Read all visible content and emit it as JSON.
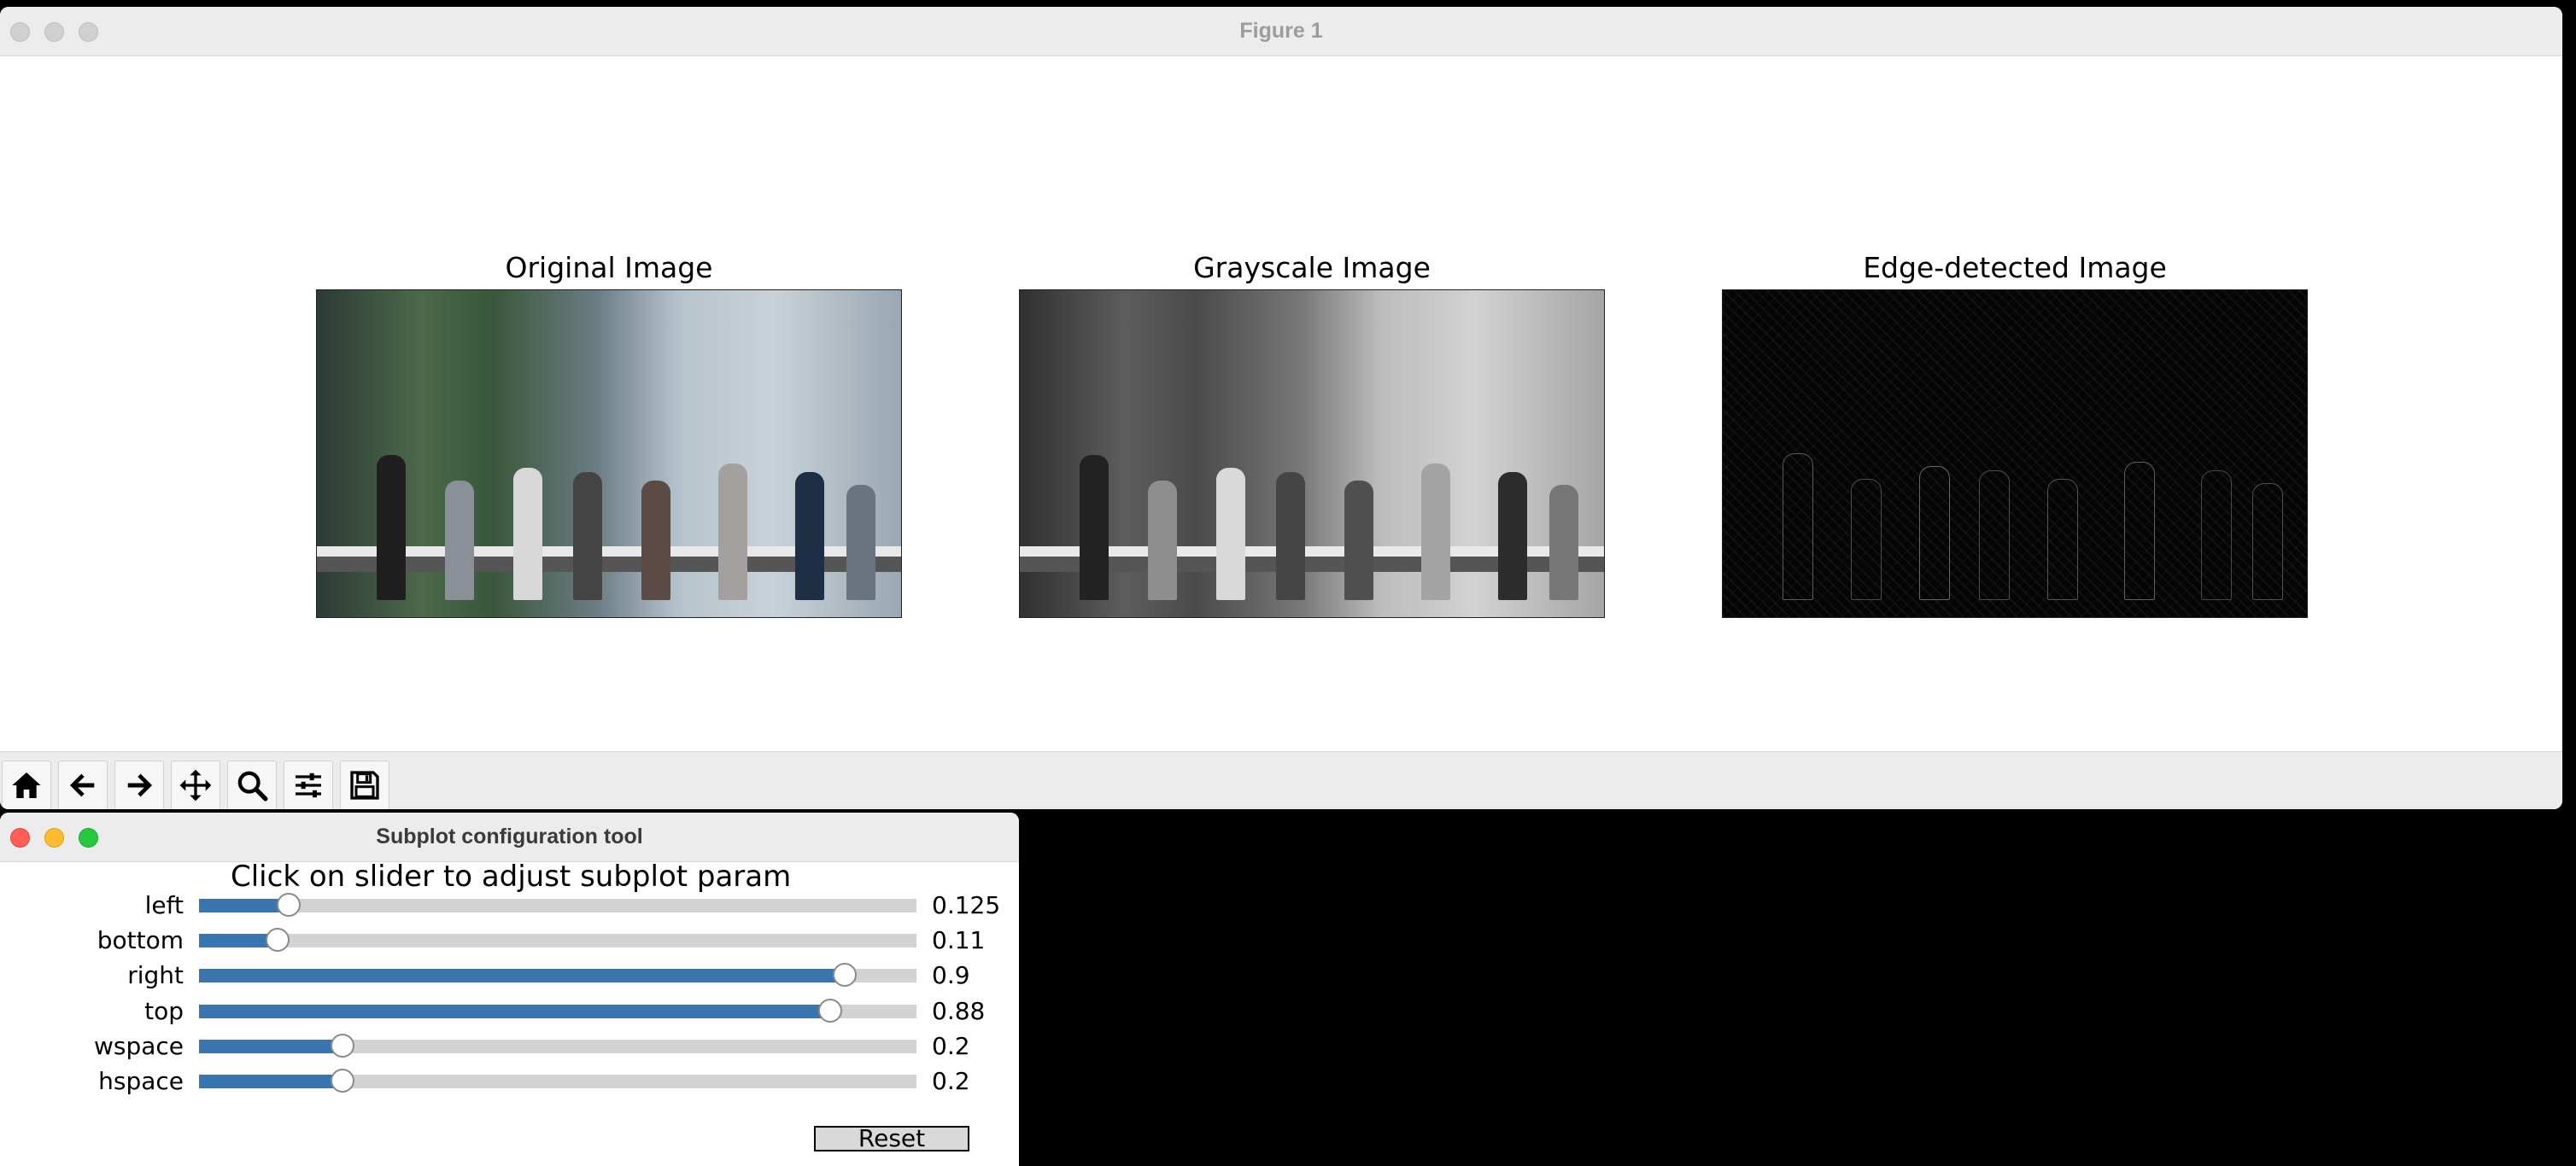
{
  "figure_window": {
    "title": "Figure 1",
    "panels": [
      {
        "title": "Original Image",
        "image": "street-crowd-color"
      },
      {
        "title": "Grayscale Image",
        "image": "street-crowd-grayscale"
      },
      {
        "title": "Edge-detected Image",
        "image": "street-crowd-edges"
      }
    ],
    "toolbar": [
      {
        "name": "home",
        "icon": "home-icon"
      },
      {
        "name": "back",
        "icon": "arrow-left-icon"
      },
      {
        "name": "forward",
        "icon": "arrow-right-icon"
      },
      {
        "name": "pan",
        "icon": "move-icon"
      },
      {
        "name": "zoom",
        "icon": "magnifier-icon"
      },
      {
        "name": "configure-subplots",
        "icon": "sliders-icon"
      },
      {
        "name": "save",
        "icon": "floppy-disk-icon"
      }
    ]
  },
  "config_window": {
    "title": "Subplot configuration tool",
    "instructions": "Click on slider to adjust subplot param",
    "sliders": [
      {
        "label": "left",
        "value": 0.125,
        "value_text": "0.125"
      },
      {
        "label": "bottom",
        "value": 0.11,
        "value_text": "0.11"
      },
      {
        "label": "right",
        "value": 0.9,
        "value_text": "0.9"
      },
      {
        "label": "top",
        "value": 0.88,
        "value_text": "0.88"
      },
      {
        "label": "wspace",
        "value": 0.2,
        "value_text": "0.2"
      },
      {
        "label": "hspace",
        "value": 0.2,
        "value_text": "0.2"
      }
    ],
    "reset_label": "Reset"
  },
  "colors": {
    "slider_fill": "#3a75b0",
    "slider_track": "#d3d3d3",
    "close": "#ff5f57",
    "minimize": "#febc2e",
    "zoom": "#28c840"
  }
}
